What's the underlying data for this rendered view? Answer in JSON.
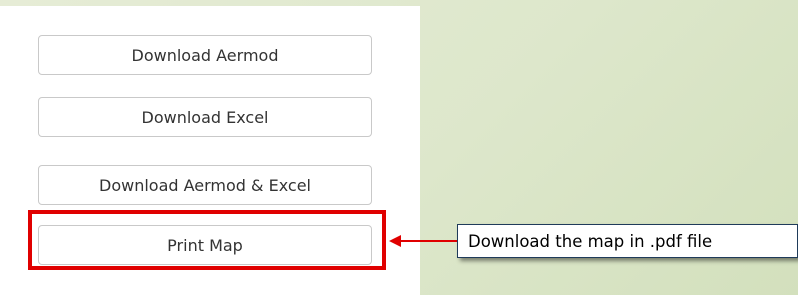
{
  "buttons": {
    "download_aermod": "Download Aermod",
    "download_excel": "Download Excel",
    "download_aermod_excel": "Download Aermod & Excel",
    "print_map": "Print Map"
  },
  "callout": {
    "text": "Download the map in .pdf file"
  },
  "colors": {
    "highlight": "#e00000",
    "background": "#dde7cb",
    "callout_border": "#1f3b5a"
  }
}
